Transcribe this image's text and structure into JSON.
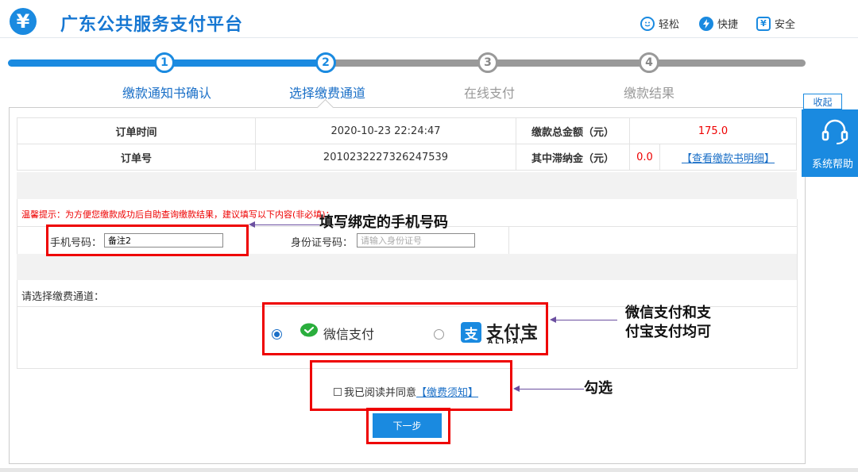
{
  "header": {
    "logo_glyph": "¥",
    "title": "广东公共服务支付平台",
    "features": [
      {
        "icon": "smile-icon",
        "label": "轻松"
      },
      {
        "icon": "lightning-icon",
        "label": "快捷"
      },
      {
        "icon": "yen-shield-icon",
        "label": "安全"
      }
    ]
  },
  "steps": [
    {
      "num": "1",
      "label": "缴款通知书确认",
      "state": "done"
    },
    {
      "num": "2",
      "label": "选择缴费通道",
      "state": "active"
    },
    {
      "num": "3",
      "label": "在线支付",
      "state": "todo"
    },
    {
      "num": "4",
      "label": "缴款结果",
      "state": "todo"
    }
  ],
  "order": {
    "time_label": "订单时间",
    "time_value": "2020-10-23 22:24:47",
    "total_label": "缴款总金额（元）",
    "total_value": "175.0",
    "id_label": "订单号",
    "id_value": "2010232227326247539",
    "late_fee_label": "其中滞纳金（元）",
    "late_fee_value": "0.0",
    "detail_link": "【查看缴款书明细】"
  },
  "form": {
    "tip": "温馨提示：为方便您缴款成功后自助查询缴款结果，建议填写以下内容(非必填)：",
    "phone_label": "手机号码：",
    "phone_value": "备注2",
    "idcard_label": "身份证号码：",
    "idcard_placeholder": "请输入身份证号"
  },
  "channel": {
    "label": "请选择缴费通道：",
    "options": [
      {
        "name": "微信支付",
        "selected": true
      },
      {
        "name": "支付宝",
        "sub": "ALIPAY",
        "selected": false
      }
    ]
  },
  "agreement": {
    "text": "我已阅读并同意",
    "link": "【缴费须知】",
    "checked": false
  },
  "next_button": "下一步",
  "annotations": {
    "phone_note": "填写绑定的手机号码",
    "pay_note_line1": "微信支付和支",
    "pay_note_line2": "付宝支付均可",
    "check_note": "勾选"
  },
  "side_help": {
    "collapse": "收起",
    "label": "系统帮助"
  },
  "colors": {
    "brand_blue": "#1a8ae0",
    "highlight_red": "#e00000",
    "arrow_purple": "#6b4fa0"
  }
}
